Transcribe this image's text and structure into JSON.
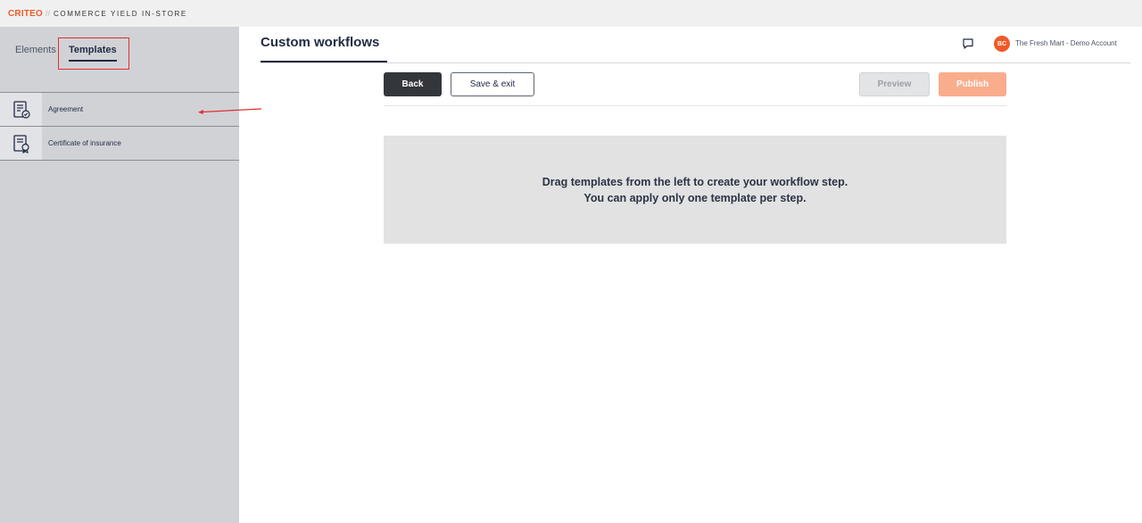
{
  "app": {
    "brand": "CRITEO",
    "separator": "//",
    "product": "COMMERCE YIELD IN-STORE"
  },
  "sidebar": {
    "tabs": [
      {
        "label": "Elements"
      },
      {
        "label": "Templates"
      }
    ],
    "templates": [
      {
        "label": "Agreement",
        "icon": "agreement-document-icon"
      },
      {
        "label": "Certificate of insurance",
        "icon": "certificate-document-icon"
      }
    ]
  },
  "header": {
    "title": "Custom workflows",
    "chat_icon": "chat-bubble-icon",
    "avatar_initials": "BC",
    "account_name": "The Fresh Mart - Demo Account"
  },
  "toolbar": {
    "back_label": "Back",
    "save_exit_label": "Save & exit",
    "preview_label": "Preview",
    "publish_label": "Publish"
  },
  "dropzone": {
    "line1": "Drag templates from the left to create your workflow step.",
    "line2": "You can apply only one template per step."
  },
  "colors": {
    "brand": "#f05a28",
    "sidebar_bg": "#d1d2d6",
    "primary_dark": "#33363b",
    "publish_disabled": "#f9ad8c",
    "annotation_red": "#e03131"
  }
}
